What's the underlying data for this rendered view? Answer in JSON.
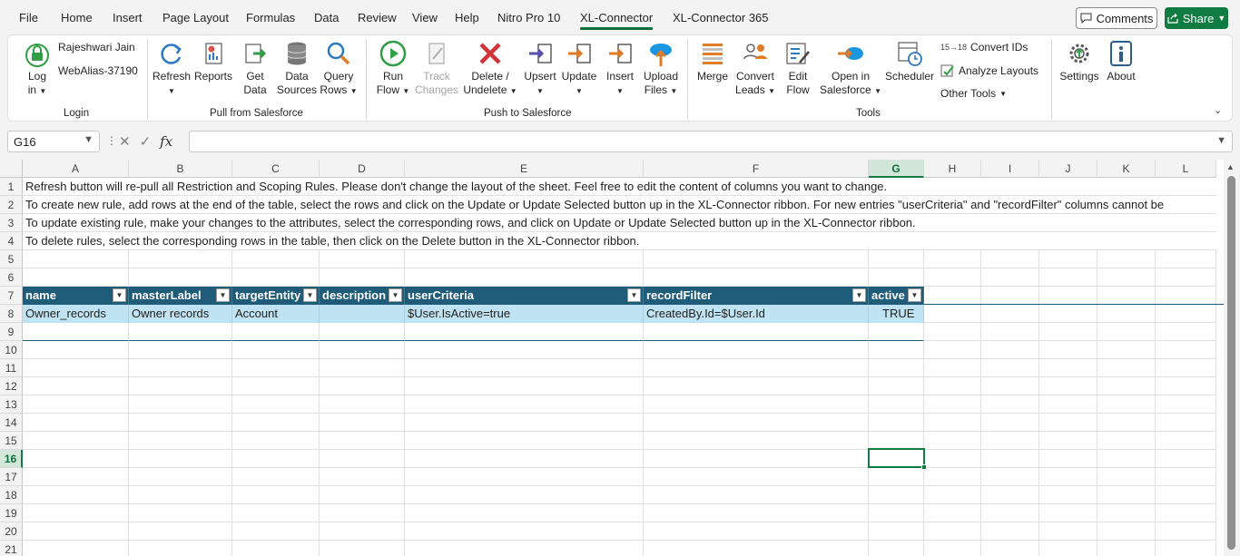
{
  "menu": {
    "tabs": [
      "File",
      "Home",
      "Insert",
      "Page Layout",
      "Formulas",
      "Data",
      "Review",
      "View",
      "Help",
      "Nitro Pro 10",
      "XL-Connector",
      "XL-Connector 365"
    ],
    "active_tab": "XL-Connector",
    "comments_label": "Comments",
    "share_label": "Share"
  },
  "ribbon": {
    "login": {
      "user_name": "Rajeshwari Jain",
      "alias": "WebAlias-37190",
      "button_line1": "Log",
      "button_line2": "in",
      "group_label": "Login"
    },
    "pull": {
      "refresh": "Refresh",
      "reports": "Reports",
      "get_data_1": "Get",
      "get_data_2": "Data",
      "data_sources_1": "Data",
      "data_sources_2": "Sources",
      "query_rows_1": "Query",
      "query_rows_2": "Rows",
      "group_label": "Pull from Salesforce"
    },
    "push": {
      "run_flow_1": "Run",
      "run_flow_2": "Flow",
      "track_changes_1": "Track",
      "track_changes_2": "Changes",
      "delete_1": "Delete /",
      "delete_2": "Undelete",
      "upsert": "Upsert",
      "update": "Update",
      "insert": "Insert",
      "upload_files_1": "Upload",
      "upload_files_2": "Files",
      "group_label": "Push to Salesforce"
    },
    "tools": {
      "merge": "Merge",
      "convert_leads_1": "Convert",
      "convert_leads_2": "Leads",
      "edit_flow_1": "Edit",
      "edit_flow_2": "Flow",
      "open_sf_1": "Open in",
      "open_sf_2": "Salesforce",
      "scheduler": "Scheduler",
      "convert_ids": "Convert IDs",
      "convert_ids_badge": "15→18",
      "analyze_layouts": "Analyze Layouts",
      "other_tools": "Other Tools",
      "group_label": "Tools"
    },
    "settings": "Settings",
    "about": "About"
  },
  "formula_bar": {
    "name_box": "G16",
    "fx": "fx",
    "value": ""
  },
  "sheet": {
    "columns": [
      "A",
      "B",
      "C",
      "D",
      "E",
      "F",
      "G",
      "H",
      "I",
      "J",
      "K",
      "L"
    ],
    "selected_column": "G",
    "rows": [
      "1",
      "2",
      "3",
      "4",
      "5",
      "6",
      "7",
      "8",
      "9",
      "10",
      "11",
      "12",
      "13",
      "14",
      "15",
      "16",
      "17",
      "18",
      "19",
      "20",
      "21"
    ],
    "selected_row": "16",
    "notes": [
      "Refresh button will re-pull all Restriction and Scoping Rules. Please don't change the layout of the sheet. Feel free to edit the content of columns you want to change.",
      "To create new rule, add rows at the end of the table, select the rows and click on the Update or Update Selected button up in the XL-Connector ribbon. For new entries \"userCriteria\" and \"recordFilter\" columns cannot be",
      "To update existing rule, make your changes to the attributes, select the corresponding rows, and click on Update or Update Selected button up in the XL-Connector ribbon.",
      "To delete rules, select the corresponding rows in the table, then click on the Delete button in the XL-Connector ribbon."
    ],
    "table": {
      "headers": [
        "name",
        "masterLabel",
        "targetEntity",
        "description",
        "userCriteria",
        "recordFilter",
        "active"
      ],
      "row": [
        "Owner_records",
        "Owner records",
        "Account",
        "",
        "$User.IsActive=true",
        "CreatedBy.Id=$User.Id",
        "TRUE"
      ]
    }
  },
  "colors": {
    "accent": "#107c41",
    "table_header": "#1f5c7a",
    "table_row": "#bfe3f2"
  }
}
